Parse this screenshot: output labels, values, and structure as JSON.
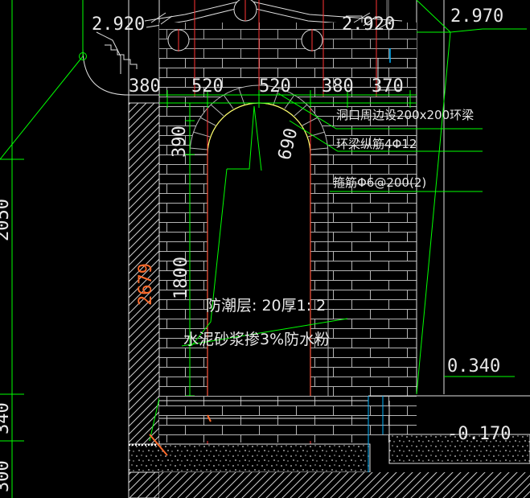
{
  "labels": {
    "elev_top_left": "2.920",
    "elev_top_mid": "2.920",
    "elev_top_right": "2.970",
    "dim_380_a": "380",
    "dim_520_a": "520",
    "dim_520_b": "520",
    "dim_380_b": "380",
    "dim_370": "370",
    "dim_390": "390",
    "dim_690": "690",
    "dim_1800": "1800",
    "dim_2679": "2679",
    "dim_2050": "2050",
    "dim_340_left": "340",
    "dim_300_left": "300",
    "note_ring_beam": "洞口周边设200x200环梁",
    "note_long_bar": "环梁纵筋4Φ12",
    "note_stirrup": "箍筋Φ6@200(2)",
    "damp_line1": "防潮层: 20厚1: 2",
    "damp_line2": "水泥砂浆掺3%防水粉",
    "elev_0340": "0.340",
    "elev_neg0170": "-0.170"
  },
  "colors": {
    "background": "#000000",
    "text": "#e8e8e8",
    "leader_green": "#00ff00",
    "arch_yellow": "#ffff66",
    "axis_red": "#ff3333",
    "hatch_gray": "#b4b4b4",
    "dim_orange": "#ff6a2a",
    "water_cyan": "#00b4ff"
  }
}
